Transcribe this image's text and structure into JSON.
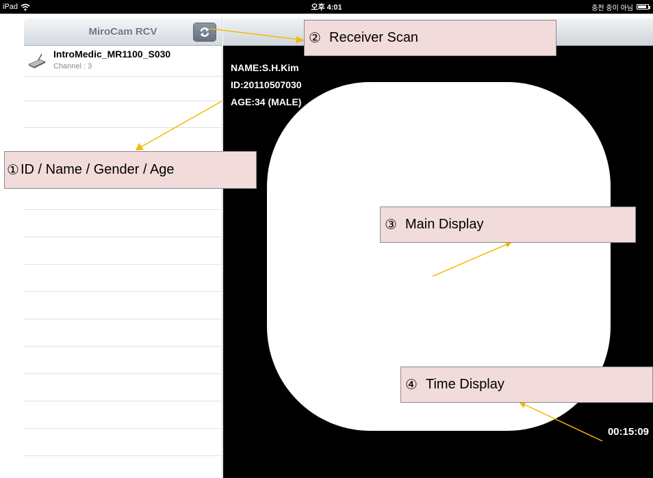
{
  "status_bar": {
    "device": "iPad",
    "time": "오후 4:01",
    "charging": "충전 중이 아님"
  },
  "master": {
    "title": "MiroCam RCV",
    "scan_icon": "refresh-icon",
    "devices": [
      {
        "name": "IntroMedic_MR1100_S030",
        "channel": "Channel : 3",
        "icon": "receiver-icon"
      }
    ]
  },
  "patient": {
    "name": "NAME:S.H.Kim",
    "id": "ID:20110507030",
    "age": "AGE:34 (MALE)"
  },
  "time_display": "00:15:09",
  "callouts": {
    "id_name": {
      "num": "①",
      "label": "ID / Name / Gender / Age"
    },
    "receiver_scan": {
      "num": "②",
      "label": "Receiver Scan"
    },
    "main_display": {
      "num": "③",
      "label": "Main Display"
    },
    "time": {
      "num": "④",
      "label": "Time Display"
    }
  },
  "colors": {
    "callout_fill": "#f2dcdb",
    "arrow": "#f5b800",
    "display_bg": "#000000"
  }
}
